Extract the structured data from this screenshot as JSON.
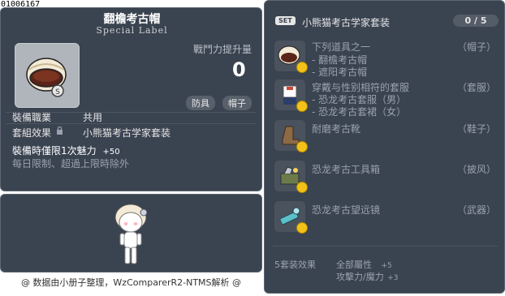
{
  "item_id": "01006167",
  "item": {
    "name": "翻檐考古帽",
    "special_label": "Special Label",
    "power_label": "戰鬥力提升量",
    "power_value": "0",
    "tag_armor": "防具",
    "tag_hat": "帽子",
    "job_label": "裝備職業",
    "job_value": "共用",
    "set_label": "套組效果",
    "set_value": "小熊猫考古学家套装",
    "equip_limit": "裝備時僅限1次魅力",
    "equip_limit_value": "+50",
    "daily_note": "每日限制、超過上限時除外"
  },
  "footer": {
    "credit": "@ 数据由小册子整理，WzComparerR2-NTMS解析 @"
  },
  "set_panel": {
    "badge": "SET",
    "title": "小熊猫考古学家套装",
    "count": "0 / 5",
    "items": [
      {
        "name": "下列道具之一",
        "slot": "（帽子）",
        "subs": [
          "- 翻檐考古帽",
          "- 遮阳考古帽"
        ]
      },
      {
        "name": "穿戴与性别相符的套服",
        "slot": "（套服）",
        "subs": [
          "- 恐龙考古套服（男）",
          "- 恐龙考古套裙（女）"
        ]
      },
      {
        "name": "耐磨考古靴",
        "slot": "（鞋子）",
        "subs": []
      },
      {
        "name": "恐龙考古工具箱",
        "slot": "（披风）",
        "subs": []
      },
      {
        "name": "恐龙考古望远镜",
        "slot": "（武器）",
        "subs": []
      }
    ],
    "effect_label": "5套装效果",
    "effects": [
      {
        "name": "全部屬性",
        "value": "+5"
      },
      {
        "name": "攻擊力/魔力",
        "value": "+3"
      }
    ]
  },
  "colors": {
    "panel_bg": "#3a4350",
    "coin": "#f2c21a"
  },
  "icons": [
    "hat-icon",
    "outfit-icon",
    "boot-icon",
    "toolbox-icon",
    "telescope-icon",
    "lock-icon",
    "coin-icon"
  ]
}
